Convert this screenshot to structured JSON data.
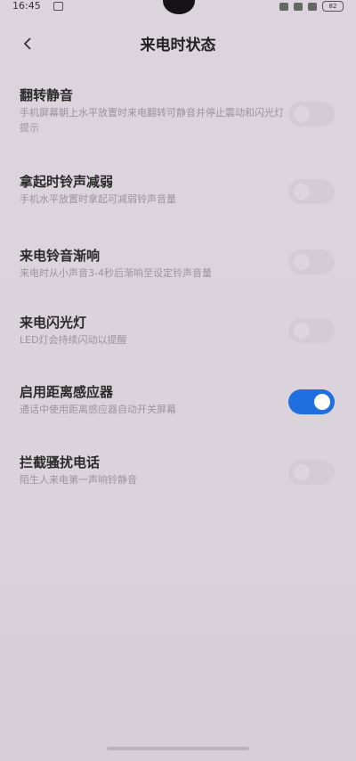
{
  "status_bar": {
    "time": "16:45",
    "battery": "82"
  },
  "header": {
    "title": "来电时状态"
  },
  "settings": [
    {
      "title": "翻转静音",
      "desc": "手机屏幕朝上水平放置时来电翻转可静音并停止震动和闪光灯提示",
      "on": false
    },
    {
      "title": "拿起时铃声减弱",
      "desc": "手机水平放置时拿起可减弱铃声音量",
      "on": false
    },
    {
      "title": "来电铃音渐响",
      "desc": "来电时从小声音3-4秒后渐响至设定铃声音量",
      "on": false
    },
    {
      "title": "来电闪光灯",
      "desc": "LED灯会持续闪动以提醒",
      "on": false
    },
    {
      "title": "启用距离感应器",
      "desc": "通话中使用距离感应器自动开关屏幕",
      "on": true
    },
    {
      "title": "拦截骚扰电话",
      "desc": "陌生人来电第一声响铃静音",
      "on": false
    }
  ],
  "colors": {
    "accent": "#1f6fe0",
    "background": "#dbd3db"
  }
}
